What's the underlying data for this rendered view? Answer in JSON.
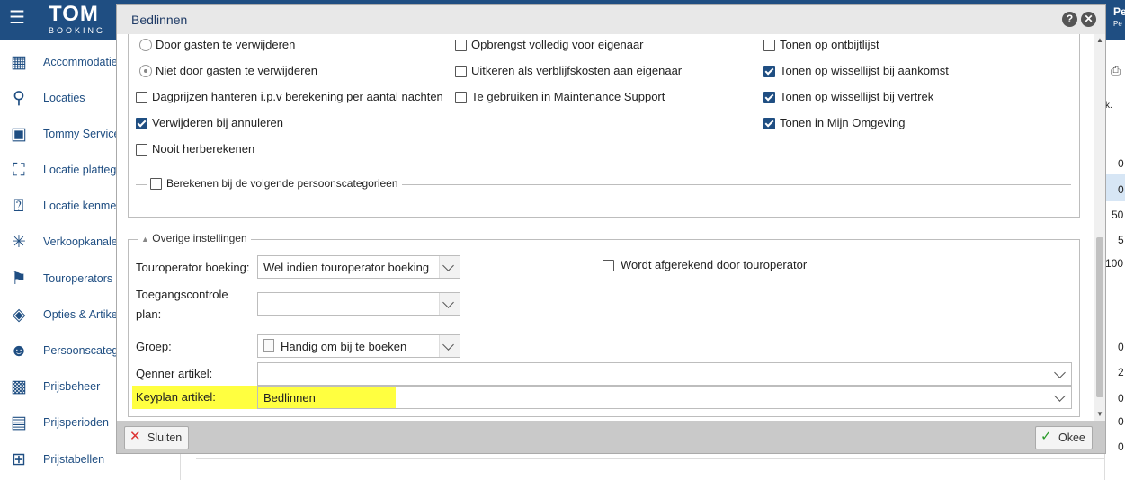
{
  "app": {
    "brand_main": "TOM",
    "brand_sub": "BOOKING",
    "user_name": "Pe",
    "user_sub": "Pe"
  },
  "sidebar": {
    "items": [
      {
        "label": "Accommodaties",
        "icon": "building-icon"
      },
      {
        "label": "Locaties",
        "icon": "map-pin-icon"
      },
      {
        "label": "Tommy Service",
        "icon": "badge-icon"
      },
      {
        "label": "Locatie plattegr",
        "icon": "map-icon"
      },
      {
        "label": "Locatie kenmer",
        "icon": "location-question-icon"
      },
      {
        "label": "Verkoopkanalen",
        "icon": "network-icon"
      },
      {
        "label": "Touroperators",
        "icon": "hiker-icon"
      },
      {
        "label": "Opties & Artikel",
        "icon": "layers-icon"
      },
      {
        "label": "Persoonscateg",
        "icon": "users-icon"
      },
      {
        "label": "Prijsbeheer",
        "icon": "calculator-icon"
      },
      {
        "label": "Prijsperioden",
        "icon": "calendar-icon"
      },
      {
        "label": "Prijstabellen",
        "icon": "table-icon"
      }
    ]
  },
  "background_right": {
    "col_values": [
      "0",
      "0",
      "50",
      "5",
      "100",
      "0",
      "2",
      "0",
      "0",
      "0"
    ],
    "letter": "k."
  },
  "dialog": {
    "title": "Bedlinnen",
    "help": "?",
    "close": "✕",
    "col1_options": [
      {
        "type": "radio",
        "label": "Door gasten te verwijderen",
        "checked": false
      },
      {
        "type": "radio",
        "label": "Niet door gasten te verwijderen",
        "checked": true
      },
      {
        "type": "checkbox",
        "label": "Dagprijzen hanteren i.p.v berekening per aantal nachten",
        "checked": false
      },
      {
        "type": "checkbox",
        "label": "Verwijderen bij annuleren",
        "checked": true
      },
      {
        "type": "checkbox",
        "label": "Nooit herberekenen",
        "checked": false
      }
    ],
    "col2_options": [
      {
        "label": "Opbrengst volledig voor eigenaar",
        "checked": false
      },
      {
        "label": "Uitkeren als verblijfskosten aan eigenaar",
        "checked": false
      },
      {
        "label": "Te gebruiken in Maintenance Support",
        "checked": false
      }
    ],
    "col3_options": [
      {
        "label": "Tonen op ontbijtlijst",
        "checked": false
      },
      {
        "label": "Tonen op wissellijst bij aankomst",
        "checked": true
      },
      {
        "label": "Tonen op wissellijst bij vertrek",
        "checked": true
      },
      {
        "label": "Tonen in Mijn Omgeving",
        "checked": true
      }
    ],
    "persons_section": {
      "label": "Berekenen bij de volgende persoonscategorieen",
      "checked": false
    },
    "other_section": {
      "legend": "Overige instellingen",
      "touroperator_label": "Touroperator boeking:",
      "touroperator_value": "Wel indien touroperator boeking",
      "toegang_label_1": "Toegangscontrole",
      "toegang_label_2": "plan:",
      "toegang_value": "",
      "groep_label": "Groep:",
      "groep_value": "Handig om bij te boeken",
      "qenner_label": "Qenner artikel:",
      "qenner_value": "",
      "keyplan_label": "Keyplan artikel:",
      "keyplan_value": "Bedlinnen",
      "afgerekend_label": "Wordt afgerekend door touroperator",
      "afgerekend_checked": false
    },
    "buttons": {
      "close": "Sluiten",
      "ok": "Okee"
    },
    "colors": {
      "highlight": "#ffff40",
      "brand": "#1f4e82"
    }
  }
}
